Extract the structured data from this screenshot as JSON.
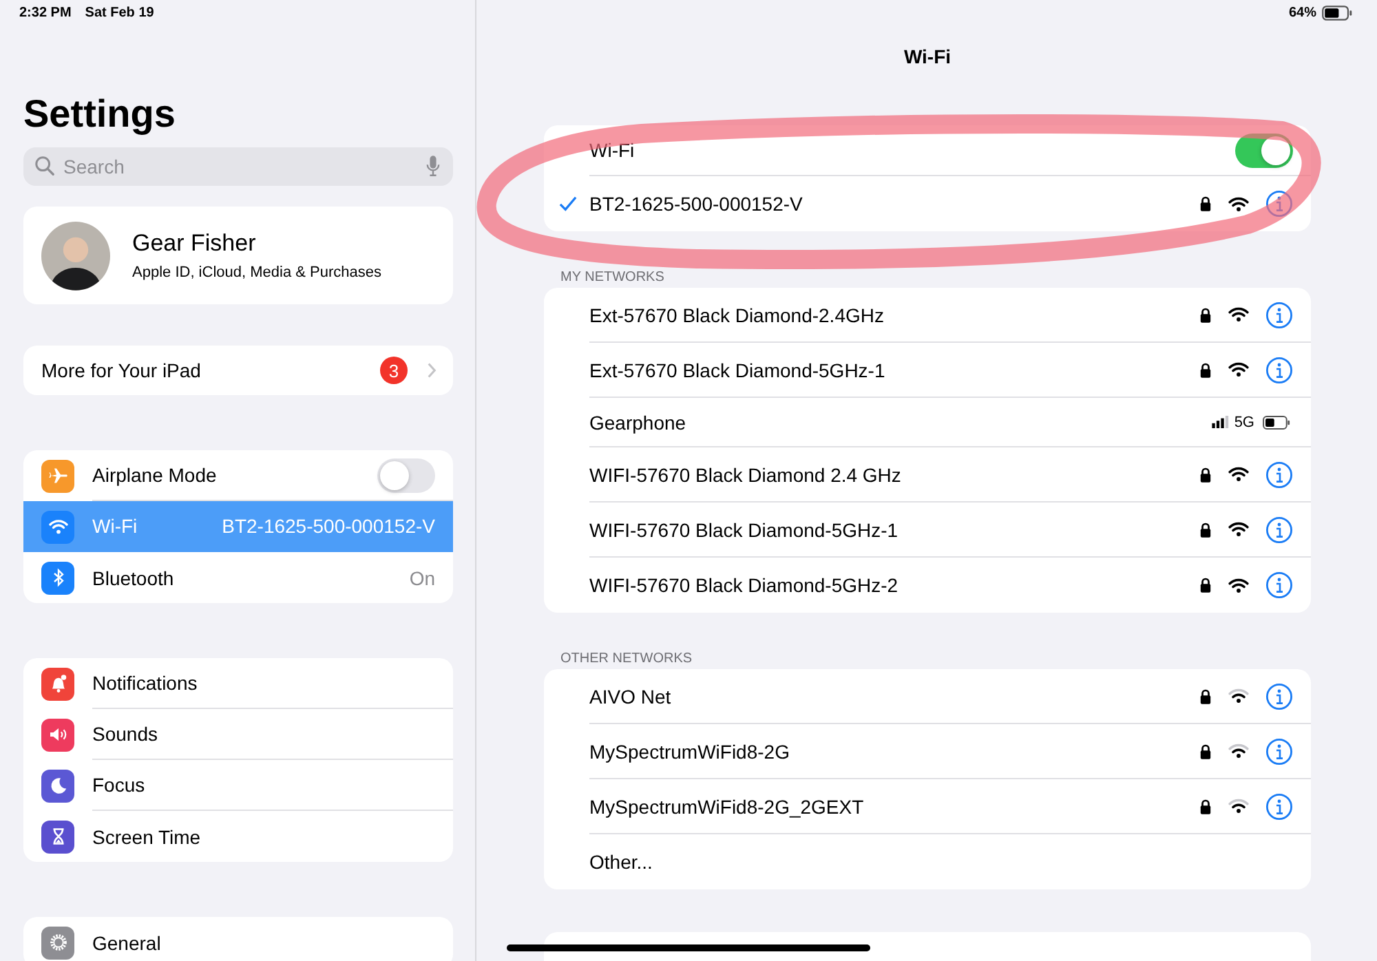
{
  "status_bar": {
    "time": "2:32 PM",
    "date": "Sat Feb 19",
    "battery": "64%"
  },
  "sidebar": {
    "title": "Settings",
    "search": {
      "placeholder": "Search"
    },
    "profile": {
      "name": "Gear Fisher",
      "subtitle": "Apple ID, iCloud, Media & Purchases"
    },
    "more": {
      "label": "More for Your iPad",
      "badge": "3"
    },
    "groups": [
      [
        {
          "label": "Airplane Mode",
          "color": "#f7982b",
          "kind": "toggle",
          "on": false,
          "selected": false
        },
        {
          "label": "Wi-Fi",
          "color": "#1a82fb",
          "kind": "value",
          "value": "BT2-1625-500-000152-V",
          "selected": true
        },
        {
          "label": "Bluetooth",
          "color": "#1a82fb",
          "kind": "value",
          "value": "On",
          "selected": false
        }
      ],
      [
        {
          "label": "Notifications",
          "color": "#f0443a",
          "kind": "link",
          "selected": false
        },
        {
          "label": "Sounds",
          "color": "#ee3b5e",
          "kind": "link",
          "selected": false
        },
        {
          "label": "Focus",
          "color": "#5b58d4",
          "kind": "link",
          "selected": false
        },
        {
          "label": "Screen Time",
          "color": "#5a4fcf",
          "kind": "link",
          "selected": false
        }
      ],
      [
        {
          "label": "General",
          "color": "#8e8e93",
          "kind": "link",
          "selected": false
        }
      ]
    ]
  },
  "detail": {
    "title": "Wi-Fi",
    "wifi_toggle": {
      "label": "Wi-Fi",
      "on": true
    },
    "connected": {
      "name": "BT2-1625-500-000152-V",
      "selected": true,
      "locked": true,
      "strong_signal": true
    },
    "sections": [
      {
        "header": "MY NETWORKS",
        "networks": [
          {
            "kind": "wifi",
            "name": "Ext-57670 Black Diamond-2.4GHz",
            "locked": true,
            "strong_signal": true
          },
          {
            "kind": "wifi",
            "name": "Ext-57670 Black Diamond-5GHz-1",
            "locked": true,
            "strong_signal": true
          },
          {
            "kind": "hotspot",
            "name": "Gearphone",
            "network": "5G"
          },
          {
            "kind": "wifi",
            "name": "WIFI-57670 Black Diamond 2.4 GHz",
            "locked": true,
            "strong_signal": true
          },
          {
            "kind": "wifi",
            "name": "WIFI-57670 Black Diamond-5GHz-1",
            "locked": true,
            "strong_signal": true
          },
          {
            "kind": "wifi",
            "name": "WIFI-57670 Black Diamond-5GHz-2",
            "locked": true,
            "strong_signal": true
          }
        ]
      },
      {
        "header": "OTHER NETWORKS",
        "networks": [
          {
            "kind": "wifi",
            "name": "AIVO Net",
            "locked": true,
            "strong_signal": false
          },
          {
            "kind": "wifi",
            "name": "MySpectrumWiFid8-2G",
            "locked": true,
            "strong_signal": false
          },
          {
            "kind": "wifi",
            "name": "MySpectrumWiFid8-2G_2GEXT",
            "locked": true,
            "strong_signal": false
          },
          {
            "kind": "other",
            "name": "Other..."
          }
        ]
      }
    ]
  }
}
